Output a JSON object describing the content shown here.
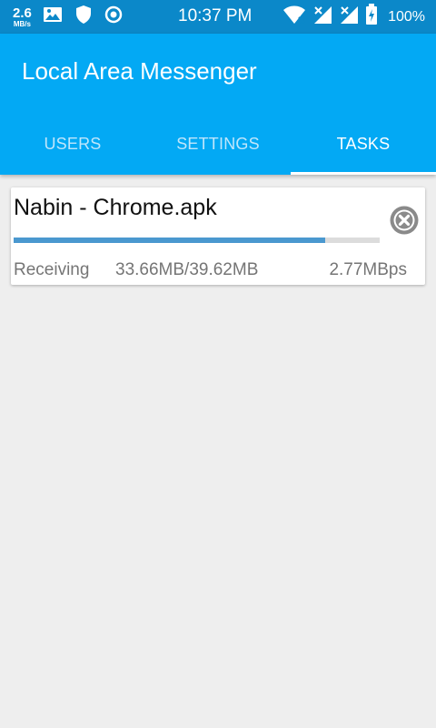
{
  "status_bar": {
    "net_speed_value": "2.6",
    "net_speed_unit": "MB/s",
    "left_icons": [
      "image-icon",
      "shield-icon",
      "radio-target-icon"
    ],
    "time": "10:37 PM",
    "right_icons": [
      "wifi-icon",
      "signal-no-service-icon",
      "signal-no-service-icon",
      "battery-charging-icon"
    ],
    "battery": "100%"
  },
  "app_bar": {
    "title": "Local Area Messenger",
    "color": "#03a9f4"
  },
  "tabs": [
    {
      "label": "USERS",
      "active": false
    },
    {
      "label": "SETTINGS",
      "active": false
    },
    {
      "label": "TASKS",
      "active": true
    }
  ],
  "tasks": [
    {
      "title": "Nabin - Chrome.apk",
      "status": "Receiving",
      "size": "33.66MB/39.62MB",
      "speed": "2.77MBps",
      "progress_fraction": 0.85,
      "cancel_icon": "cancel-circle-icon"
    }
  ],
  "colors": {
    "status_bar": "#0b88c9",
    "accent": "#03a9f4",
    "progress": "#4a98cf",
    "background": "#eeeeee"
  }
}
